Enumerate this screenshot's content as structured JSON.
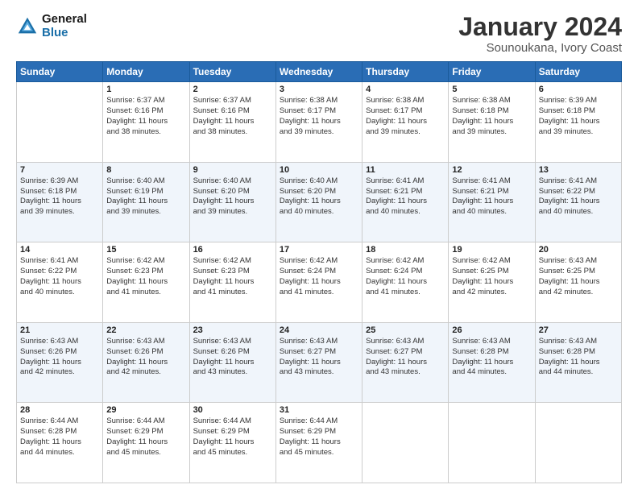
{
  "logo": {
    "line1": "General",
    "line2": "Blue"
  },
  "title": "January 2024",
  "subtitle": "Sounoukana, Ivory Coast",
  "header_days": [
    "Sunday",
    "Monday",
    "Tuesday",
    "Wednesday",
    "Thursday",
    "Friday",
    "Saturday"
  ],
  "weeks": [
    [
      {
        "num": "",
        "info": ""
      },
      {
        "num": "1",
        "info": "Sunrise: 6:37 AM\nSunset: 6:16 PM\nDaylight: 11 hours\nand 38 minutes."
      },
      {
        "num": "2",
        "info": "Sunrise: 6:37 AM\nSunset: 6:16 PM\nDaylight: 11 hours\nand 38 minutes."
      },
      {
        "num": "3",
        "info": "Sunrise: 6:38 AM\nSunset: 6:17 PM\nDaylight: 11 hours\nand 39 minutes."
      },
      {
        "num": "4",
        "info": "Sunrise: 6:38 AM\nSunset: 6:17 PM\nDaylight: 11 hours\nand 39 minutes."
      },
      {
        "num": "5",
        "info": "Sunrise: 6:38 AM\nSunset: 6:18 PM\nDaylight: 11 hours\nand 39 minutes."
      },
      {
        "num": "6",
        "info": "Sunrise: 6:39 AM\nSunset: 6:18 PM\nDaylight: 11 hours\nand 39 minutes."
      }
    ],
    [
      {
        "num": "7",
        "info": "Sunrise: 6:39 AM\nSunset: 6:18 PM\nDaylight: 11 hours\nand 39 minutes."
      },
      {
        "num": "8",
        "info": "Sunrise: 6:40 AM\nSunset: 6:19 PM\nDaylight: 11 hours\nand 39 minutes."
      },
      {
        "num": "9",
        "info": "Sunrise: 6:40 AM\nSunset: 6:20 PM\nDaylight: 11 hours\nand 39 minutes."
      },
      {
        "num": "10",
        "info": "Sunrise: 6:40 AM\nSunset: 6:20 PM\nDaylight: 11 hours\nand 40 minutes."
      },
      {
        "num": "11",
        "info": "Sunrise: 6:41 AM\nSunset: 6:21 PM\nDaylight: 11 hours\nand 40 minutes."
      },
      {
        "num": "12",
        "info": "Sunrise: 6:41 AM\nSunset: 6:21 PM\nDaylight: 11 hours\nand 40 minutes."
      },
      {
        "num": "13",
        "info": "Sunrise: 6:41 AM\nSunset: 6:22 PM\nDaylight: 11 hours\nand 40 minutes."
      }
    ],
    [
      {
        "num": "14",
        "info": "Sunrise: 6:41 AM\nSunset: 6:22 PM\nDaylight: 11 hours\nand 40 minutes."
      },
      {
        "num": "15",
        "info": "Sunrise: 6:42 AM\nSunset: 6:23 PM\nDaylight: 11 hours\nand 41 minutes."
      },
      {
        "num": "16",
        "info": "Sunrise: 6:42 AM\nSunset: 6:23 PM\nDaylight: 11 hours\nand 41 minutes."
      },
      {
        "num": "17",
        "info": "Sunrise: 6:42 AM\nSunset: 6:24 PM\nDaylight: 11 hours\nand 41 minutes."
      },
      {
        "num": "18",
        "info": "Sunrise: 6:42 AM\nSunset: 6:24 PM\nDaylight: 11 hours\nand 41 minutes."
      },
      {
        "num": "19",
        "info": "Sunrise: 6:42 AM\nSunset: 6:25 PM\nDaylight: 11 hours\nand 42 minutes."
      },
      {
        "num": "20",
        "info": "Sunrise: 6:43 AM\nSunset: 6:25 PM\nDaylight: 11 hours\nand 42 minutes."
      }
    ],
    [
      {
        "num": "21",
        "info": "Sunrise: 6:43 AM\nSunset: 6:26 PM\nDaylight: 11 hours\nand 42 minutes."
      },
      {
        "num": "22",
        "info": "Sunrise: 6:43 AM\nSunset: 6:26 PM\nDaylight: 11 hours\nand 42 minutes."
      },
      {
        "num": "23",
        "info": "Sunrise: 6:43 AM\nSunset: 6:26 PM\nDaylight: 11 hours\nand 43 minutes."
      },
      {
        "num": "24",
        "info": "Sunrise: 6:43 AM\nSunset: 6:27 PM\nDaylight: 11 hours\nand 43 minutes."
      },
      {
        "num": "25",
        "info": "Sunrise: 6:43 AM\nSunset: 6:27 PM\nDaylight: 11 hours\nand 43 minutes."
      },
      {
        "num": "26",
        "info": "Sunrise: 6:43 AM\nSunset: 6:28 PM\nDaylight: 11 hours\nand 44 minutes."
      },
      {
        "num": "27",
        "info": "Sunrise: 6:43 AM\nSunset: 6:28 PM\nDaylight: 11 hours\nand 44 minutes."
      }
    ],
    [
      {
        "num": "28",
        "info": "Sunrise: 6:44 AM\nSunset: 6:28 PM\nDaylight: 11 hours\nand 44 minutes."
      },
      {
        "num": "29",
        "info": "Sunrise: 6:44 AM\nSunset: 6:29 PM\nDaylight: 11 hours\nand 45 minutes."
      },
      {
        "num": "30",
        "info": "Sunrise: 6:44 AM\nSunset: 6:29 PM\nDaylight: 11 hours\nand 45 minutes."
      },
      {
        "num": "31",
        "info": "Sunrise: 6:44 AM\nSunset: 6:29 PM\nDaylight: 11 hours\nand 45 minutes."
      },
      {
        "num": "",
        "info": ""
      },
      {
        "num": "",
        "info": ""
      },
      {
        "num": "",
        "info": ""
      }
    ]
  ]
}
